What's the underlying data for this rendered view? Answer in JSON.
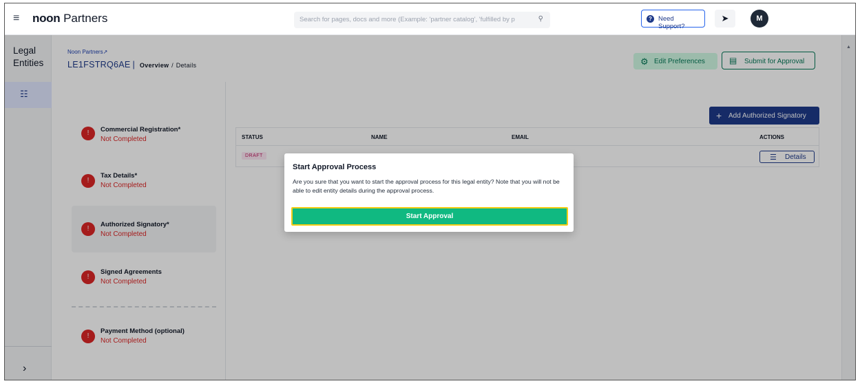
{
  "topbar": {
    "menu_icon": "≡",
    "logo_bold": "noon",
    "logo_rest": " Partners",
    "search_placeholder": "Search for pages, docs and more (Example: 'partner catalog', 'fulfilled by p",
    "support_label": "Need Support?",
    "avatar_initial": "M"
  },
  "rail": {
    "title_line1": "Legal",
    "title_line2": "Entities",
    "expand_icon": "›"
  },
  "header": {
    "breadcrumb": "Noon Partners",
    "entity_id": "LE1FSTRQ6AE",
    "crumb_overview": "Overview",
    "crumb_sep": "/",
    "crumb_details": "Details",
    "edit_preferences": "Edit Preferences",
    "submit_for_approval": "Submit for Approval"
  },
  "steps": [
    {
      "title": "Commercial Registration*",
      "status": "Not Completed"
    },
    {
      "title": "Tax Details*",
      "status": "Not Completed"
    },
    {
      "title": "Authorized Signatory*",
      "status": "Not Completed"
    },
    {
      "title": "Signed Agreements",
      "status": "Not Completed"
    },
    {
      "title": "Payment Method (optional)",
      "status": "Not Completed"
    }
  ],
  "signatories": {
    "add_button": "Add Authorized Signatory",
    "columns": [
      "STATUS",
      "NAME",
      "EMAIL",
      "ACTIONS"
    ],
    "rows": [
      {
        "status": "DRAFT",
        "action": "Details"
      }
    ]
  },
  "modal": {
    "title": "Start Approval Process",
    "body": "Are you sure that you want to start the approval process for this legal entity? Note that you will not be able to edit entity details during the approval process.",
    "button": "Start Approval"
  },
  "colors": {
    "primary": "#1e3a8a",
    "success": "#10b981",
    "danger": "#dc2626",
    "focus_ring": "#facc15"
  }
}
